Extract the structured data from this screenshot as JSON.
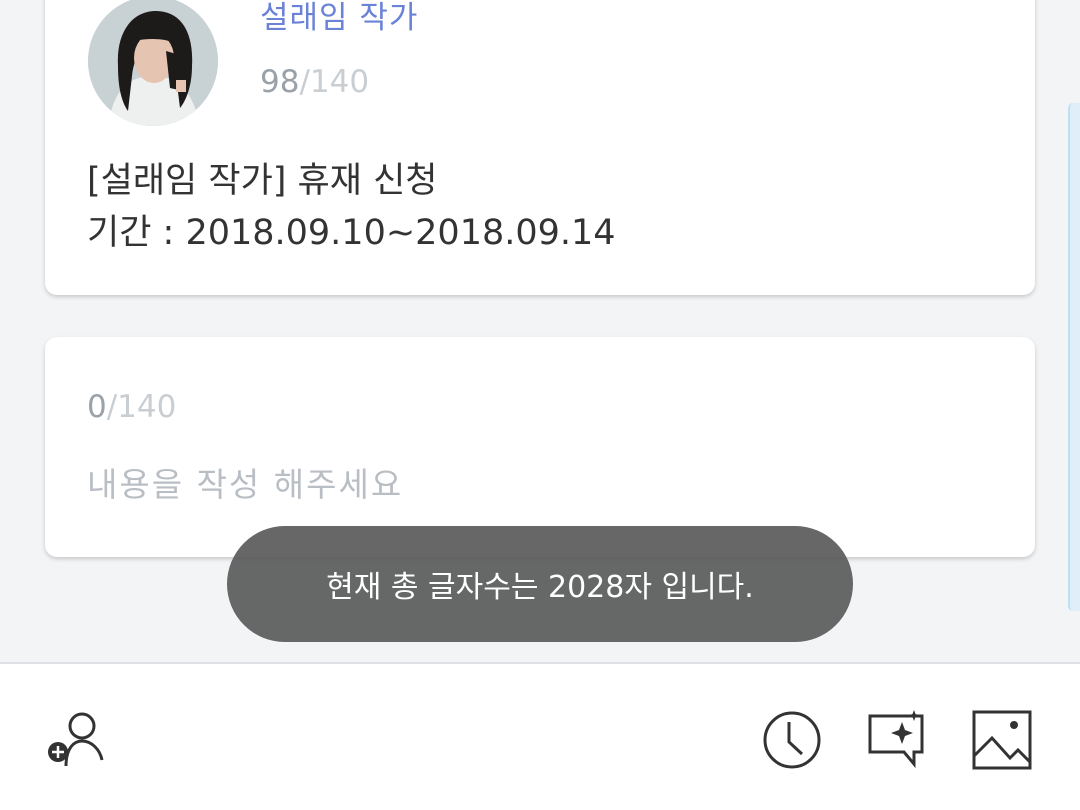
{
  "post": {
    "author_name": "설래임 작가",
    "count_current": "98",
    "count_max": "/140",
    "body_line1": "[설래임 작가] 휴재 신청",
    "body_line2": "기간 : 2018.09.10~2018.09.14"
  },
  "reply": {
    "count_current": "0",
    "count_max": "/140",
    "placeholder": "내용을 작성 해주세요"
  },
  "toast": {
    "message": "현재 총 글자수는 2028자 입니다."
  },
  "toolbar": {
    "icons": [
      "add-user-icon",
      "clock-icon",
      "sparkle-message-icon",
      "image-icon"
    ]
  },
  "colors": {
    "author_accent": "#6b83d6",
    "toast_bg": "#5a5a5a"
  }
}
